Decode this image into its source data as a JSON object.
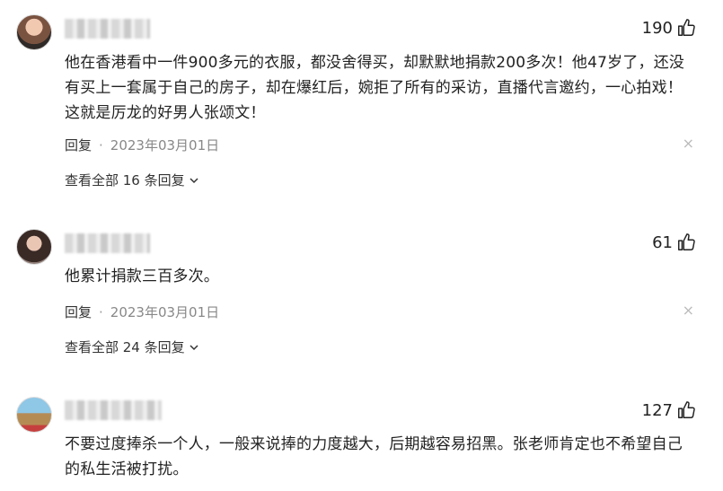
{
  "comments": [
    {
      "likes": "190",
      "text": "他在香港看中一件900多元的衣服，都没舍得买，却默默地捐款200多次！他47岁了，还没有买上一套属于自己的房子，却在爆红后，婉拒了所有的采访，直播代言邀约，一心拍戏！这就是厉龙的好男人张颂文！",
      "reply_label": "回复",
      "dot": "·",
      "date": "2023年03月01日",
      "close": "×",
      "view_all": "查看全部 16 条回复"
    },
    {
      "likes": "61",
      "text": "他累计捐款三百多次。",
      "reply_label": "回复",
      "dot": "·",
      "date": "2023年03月01日",
      "close": "×",
      "view_all": "查看全部 24 条回复"
    },
    {
      "likes": "127",
      "text": "不要过度捧杀一个人，一般来说捧的力度越大，后期越容易招黑。张老师肯定也不希望自己的私生活被打扰。"
    }
  ],
  "icons": {
    "thumb": "thumbs-up-icon",
    "chevron": "chevron-down-icon",
    "close": "close-icon"
  },
  "colors": {
    "text": "#222222",
    "meta": "#888888"
  }
}
